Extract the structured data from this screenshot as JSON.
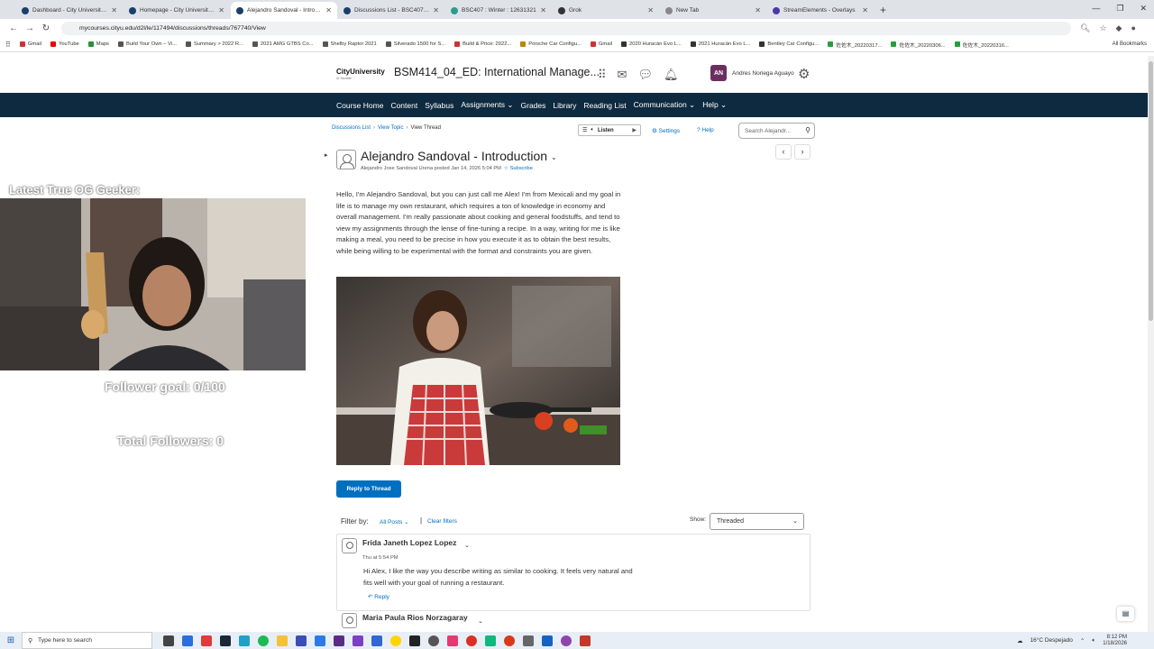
{
  "browser": {
    "tabs": [
      {
        "title": "Dashboard - City University of"
      },
      {
        "title": "Homepage - City University of"
      },
      {
        "title": "Alejandro Sandoval - Introduct"
      },
      {
        "title": "Discussions List - BSC407_04_E"
      },
      {
        "title": "BSC407 : Winter : 12631321"
      },
      {
        "title": "Grok"
      },
      {
        "title": "New Tab"
      },
      {
        "title": "StreamElements - Overlays"
      }
    ],
    "url": "mycourses.cityu.edu/d2l/le/117494/discussions/threads/767740/View",
    "bookmarks": [
      "Gmail",
      "YouTube",
      "Maps",
      "Build Your Own – Vi...",
      "Summary > 2022 R...",
      "2021 AMG GTBS Co...",
      "Shelby Raptor 2021",
      "Silverado 1500 for S...",
      "Build & Price: 2022...",
      "Porsche Car Configu...",
      "Gmail",
      "2020 Huracán Evo L...",
      "2021 Huracán Evo L...",
      "Bentley Car Configu...",
      "佐佐木_20220317...",
      "佐佐木_20220306...",
      "佐佐木_20220316..."
    ],
    "all_bookmarks": "All Bookmarks"
  },
  "header": {
    "logo": "CityUniversity",
    "logo_sub": "of Seattle",
    "course_title": "BSM414_04_ED: International Manage...",
    "avatar_initials": "AN",
    "user_name": "Andres Noriega Aguayo"
  },
  "nav": {
    "items": [
      "Course Home",
      "Content",
      "Syllabus",
      "Assignments ⌄",
      "Grades",
      "Library",
      "Reading List",
      "Communication ⌄",
      "Help ⌄"
    ]
  },
  "toolbar": {
    "crumbs": [
      "Discussions List",
      "View Topic",
      "View Thread"
    ],
    "listen": "Listen",
    "settings": "Settings",
    "help": "Help",
    "search_placeholder": "Search Alejandr..."
  },
  "post": {
    "title": "Alejandro Sandoval - Introduction",
    "meta": "Alejandro Jose Sandoval Urena posted Jan 14, 2026 5:04 PM",
    "subscribe": "Subscribe",
    "body": "Hello, I'm Alejandro Sandoval, but you can just call me Alex! I'm from Mexicali and my goal in life is to manage my own restaurant, which requires a ton of knowledge in economy and overall management. I'm really passionate about cooking and general foodstuffs, and tend to view my assignments through the lense of fine-tuning a recipe. In a way, writing for me is like making a meal, you need to be precise in how you execute it as to obtain the best results, while being willing to be experimental with the format and constraints you are given.",
    "reply_button": "Reply to Thread"
  },
  "filters": {
    "label": "Filter by:",
    "all_posts": "All Posts ⌄",
    "divider": "|",
    "clear": "Clear filters",
    "show_label": "Show:",
    "show_value": "Threaded"
  },
  "replies": [
    {
      "name": "Frida Janeth Lopez Lopez",
      "date": "Thu at 5:54 PM",
      "body": "Hi Alex, I like the way you describe writing as similar to cooking. It feels very natural and fits well with your goal of running a restaurant.",
      "reply": "Reply"
    },
    {
      "name": "Maria Paula Rios Norzagaray"
    }
  ],
  "overlay": {
    "title": "Latest True OG Geeker:",
    "follower_goal": "Follower goal: 0/100",
    "total_followers": "Total Followers: 0"
  },
  "taskbar": {
    "search_placeholder": "Type here to search",
    "weather": "16°C  Despejado",
    "time": "8:12 PM",
    "date": "1/18/2026"
  }
}
